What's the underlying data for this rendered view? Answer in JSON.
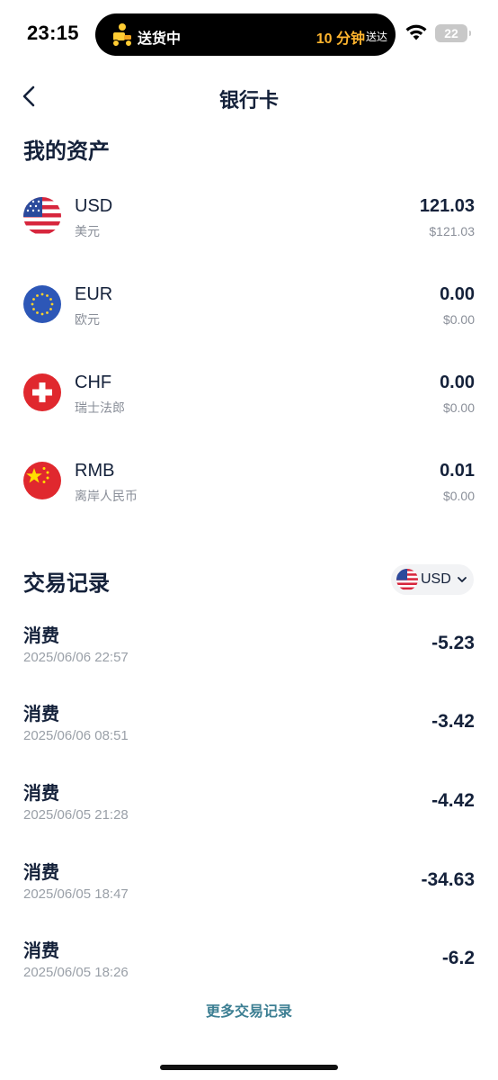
{
  "status_bar": {
    "time": "23:15",
    "island_status": "送货中",
    "island_eta": "10 分钟",
    "island_eta_suffix": "送达",
    "battery": "22"
  },
  "nav": {
    "title": "银行卡",
    "back_icon": "chevron-left-icon"
  },
  "assets": {
    "title": "我的资产",
    "items": [
      {
        "code": "USD",
        "name": "美元",
        "amount": "121.03",
        "value": "$121.03",
        "flag": "us-flag-icon"
      },
      {
        "code": "EUR",
        "name": "欧元",
        "amount": "0.00",
        "value": "$0.00",
        "flag": "eu-flag-icon"
      },
      {
        "code": "CHF",
        "name": "瑞士法郎",
        "amount": "0.00",
        "value": "$0.00",
        "flag": "ch-flag-icon"
      },
      {
        "code": "RMB",
        "name": "离岸人民币",
        "amount": "0.01",
        "value": "$0.00",
        "flag": "cn-flag-icon"
      }
    ]
  },
  "transactions": {
    "title": "交易记录",
    "currency_filter": "USD",
    "items": [
      {
        "type": "消费",
        "time": "2025/06/06 22:57",
        "amount": "-5.23"
      },
      {
        "type": "消费",
        "time": "2025/06/06 08:51",
        "amount": "-3.42"
      },
      {
        "type": "消费",
        "time": "2025/06/05 21:28",
        "amount": "-4.42"
      },
      {
        "type": "消费",
        "time": "2025/06/05 18:47",
        "amount": "-34.63"
      },
      {
        "type": "消费",
        "time": "2025/06/05 18:26",
        "amount": "-6.2"
      }
    ],
    "more_label": "更多交易记录"
  },
  "colors": {
    "text_primary": "#14213a",
    "text_secondary": "#8a8f99",
    "link": "#3d7f93",
    "eta_accent": "#ffb52e"
  }
}
